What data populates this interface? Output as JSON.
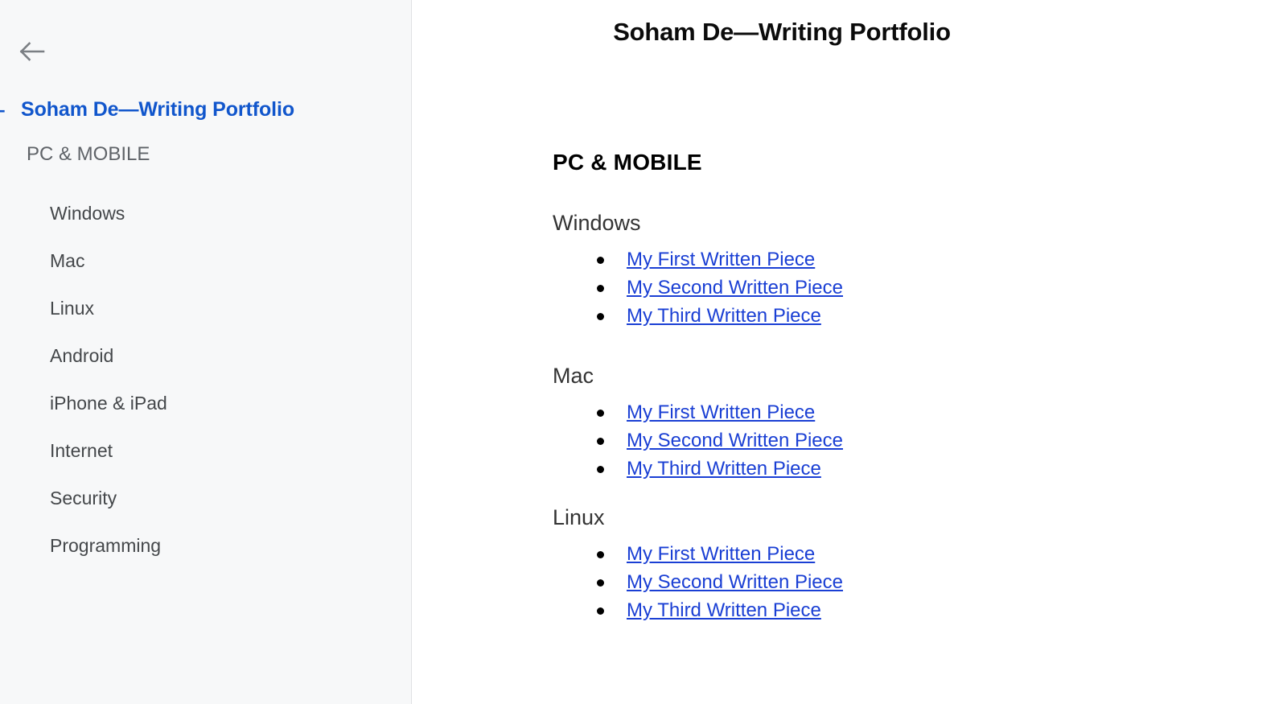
{
  "sidebar": {
    "back_icon": "arrow-left-icon",
    "collapse_toggle": "–",
    "title": "Soham De—Writing Portfolio",
    "group_label": "PC & MOBILE",
    "items": [
      {
        "label": "Windows"
      },
      {
        "label": "Mac"
      },
      {
        "label": "Linux"
      },
      {
        "label": "Android"
      },
      {
        "label": "iPhone & iPad"
      },
      {
        "label": "Internet"
      },
      {
        "label": "Security"
      },
      {
        "label": "Programming"
      }
    ]
  },
  "document": {
    "title": "Soham De—Writing Portfolio",
    "section_title": "PC & MOBILE",
    "groups": [
      {
        "heading": "Windows",
        "links": [
          {
            "label": "My First Written Piece"
          },
          {
            "label": "My Second Written Piece"
          },
          {
            "label": "My Third Written Piece"
          }
        ]
      },
      {
        "heading": "Mac",
        "links": [
          {
            "label": "My First Written Piece"
          },
          {
            "label": "My Second Written Piece"
          },
          {
            "label": "My Third Written Piece"
          }
        ]
      },
      {
        "heading": "Linux",
        "links": [
          {
            "label": "My First Written Piece"
          },
          {
            "label": "My Second Written Piece"
          },
          {
            "label": "My Third Written Piece"
          }
        ]
      }
    ]
  },
  "colors": {
    "sidebar_background": "#f7f8f9",
    "sidebar_border": "#dfe1e3",
    "sidebar_title_blue": "#1156cc",
    "sidebar_item_text": "#44474a",
    "sidebar_group_text": "#5f6368",
    "document_title_text": "#0b0b0b",
    "section_title_text": "#000000",
    "group_heading_text": "#333333",
    "link_blue": "#1a3fd4",
    "bullet": "#000000",
    "main_background": "#ffffff"
  }
}
